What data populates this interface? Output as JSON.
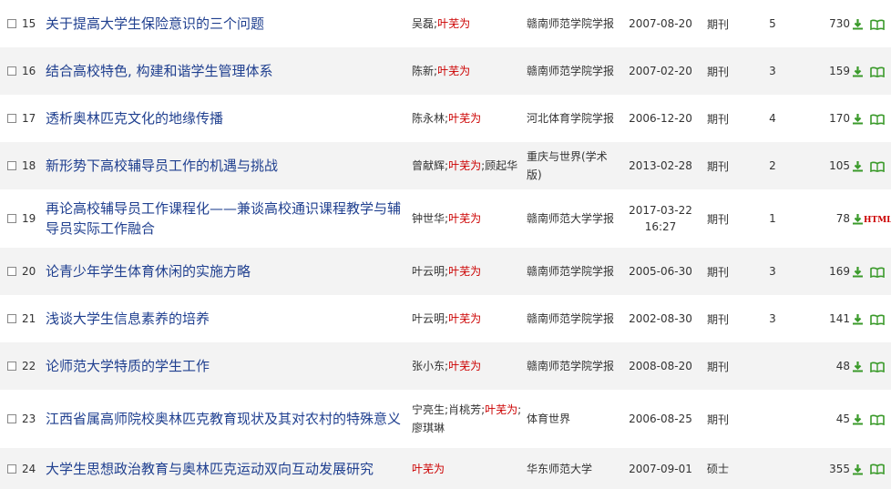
{
  "rows": [
    {
      "num": "15",
      "title": "关于提高大学生保险意识的三个问题",
      "authors": [
        {
          "n": "吴磊",
          "hl": false
        },
        {
          "n": "叶芜为",
          "hl": true
        }
      ],
      "source": "赣南师范学院学报",
      "date": "2007-08-20",
      "type": "期刊",
      "cited": "5",
      "downloads": "730",
      "read": "book"
    },
    {
      "num": "16",
      "title": "结合高校特色, 构建和谐学生管理体系",
      "authors": [
        {
          "n": "陈新",
          "hl": false
        },
        {
          "n": "叶芜为",
          "hl": true
        }
      ],
      "source": "赣南师范学院学报",
      "date": "2007-02-20",
      "type": "期刊",
      "cited": "3",
      "downloads": "159",
      "read": "book"
    },
    {
      "num": "17",
      "title": "透析奥林匹克文化的地缘传播",
      "authors": [
        {
          "n": "陈永林",
          "hl": false
        },
        {
          "n": "叶芜为",
          "hl": true
        }
      ],
      "source": "河北体育学院学报",
      "date": "2006-12-20",
      "type": "期刊",
      "cited": "4",
      "downloads": "170",
      "read": "book"
    },
    {
      "num": "18",
      "title": "新形势下高校辅导员工作的机遇与挑战",
      "authors": [
        {
          "n": "曾献辉",
          "hl": false
        },
        {
          "n": "叶芜为",
          "hl": true
        },
        {
          "n": "顾起华",
          "hl": false
        }
      ],
      "source": "重庆与世界(学术版)",
      "date": "2013-02-28",
      "type": "期刊",
      "cited": "2",
      "downloads": "105",
      "read": "book"
    },
    {
      "num": "19",
      "title": "再论高校辅导员工作课程化——兼谈高校通识课程教学与辅导员实际工作融合",
      "authors": [
        {
          "n": "钟世华",
          "hl": false
        },
        {
          "n": "叶芜为",
          "hl": true
        }
      ],
      "source": "赣南师范大学学报",
      "date": "2017-03-22 16:27",
      "type": "期刊",
      "cited": "1",
      "downloads": "78",
      "read": "HTML"
    },
    {
      "num": "20",
      "title": "论青少年学生体育休闲的实施方略",
      "authors": [
        {
          "n": "叶云明",
          "hl": false
        },
        {
          "n": "叶芜为",
          "hl": true
        }
      ],
      "source": "赣南师范学院学报",
      "date": "2005-06-30",
      "type": "期刊",
      "cited": "3",
      "downloads": "169",
      "read": "book"
    },
    {
      "num": "21",
      "title": "浅谈大学生信息素养的培养",
      "authors": [
        {
          "n": "叶云明",
          "hl": false
        },
        {
          "n": "叶芜为",
          "hl": true
        }
      ],
      "source": "赣南师范学院学报",
      "date": "2002-08-30",
      "type": "期刊",
      "cited": "3",
      "downloads": "141",
      "read": "book"
    },
    {
      "num": "22",
      "title": "论师范大学特质的学生工作",
      "authors": [
        {
          "n": "张小东",
          "hl": false
        },
        {
          "n": "叶芜为",
          "hl": true
        }
      ],
      "source": "赣南师范学院学报",
      "date": "2008-08-20",
      "type": "期刊",
      "cited": "",
      "downloads": "48",
      "read": "book"
    },
    {
      "num": "23",
      "title": "江西省属高师院校奥林匹克教育现状及其对农村的特殊意义",
      "authors": [
        {
          "n": "宁亮生",
          "hl": false
        },
        {
          "n": "肖桃芳",
          "hl": false
        },
        {
          "n": "叶芜为",
          "hl": true
        },
        {
          "n": "廖琪琳",
          "hl": false
        }
      ],
      "source": "体育世界",
      "date": "2006-08-25",
      "type": "期刊",
      "cited": "",
      "downloads": "45",
      "read": "book"
    },
    {
      "num": "24",
      "title": "大学生思想政治教育与奥林匹克运动双向互动发展研究",
      "authors": [
        {
          "n": "叶芜为",
          "hl": true
        }
      ],
      "source": "华东师范大学",
      "date": "2007-09-01",
      "type": "硕士",
      "cited": "",
      "downloads": "355",
      "read": "book"
    }
  ],
  "icons": {
    "download": "download-icon",
    "read": "book-icon"
  },
  "colors": {
    "link": "#1f3f8f",
    "highlight": "#cc0000",
    "alt_row": "#f3f3f3",
    "icon_green": "#3a9a2a"
  }
}
